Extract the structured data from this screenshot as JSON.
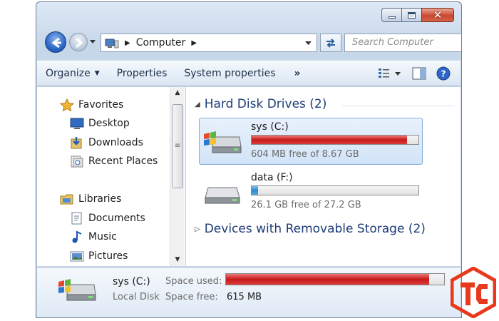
{
  "window": {
    "caption_buttons": [
      "minimize",
      "maximize",
      "close"
    ],
    "close_glyph": "✕"
  },
  "nav": {
    "address_path": [
      "Computer"
    ],
    "address_icon": "computer-icon",
    "search_placeholder": "Search Computer"
  },
  "toolbar": {
    "organize_label": "Organize",
    "properties_label": "Properties",
    "system_properties_label": "System properties",
    "more_label": "»"
  },
  "sidebar": {
    "items": [
      {
        "label": "Favorites",
        "icon": "star-icon"
      },
      {
        "label": "Desktop",
        "icon": "desktop-icon"
      },
      {
        "label": "Downloads",
        "icon": "downloads-icon"
      },
      {
        "label": "Recent Places",
        "icon": "recent-places-icon"
      },
      {
        "label": "Libraries",
        "icon": "libraries-icon"
      },
      {
        "label": "Documents",
        "icon": "documents-icon"
      },
      {
        "label": "Music",
        "icon": "music-icon"
      },
      {
        "label": "Pictures",
        "icon": "pictures-icon"
      }
    ]
  },
  "groups": {
    "hard_disks": {
      "title": "Hard Disk Drives (2)",
      "drives": [
        {
          "name": "sys (C:)",
          "free_text": "604 MB free of 8.67 GB",
          "used_fraction": 0.93,
          "bar_color": "#c61a1a",
          "selected": true
        },
        {
          "name": "data (F:)",
          "free_text": "26.1 GB free of 27.2 GB",
          "used_fraction": 0.04,
          "bar_color": "#2a88cf",
          "selected": false
        }
      ]
    },
    "removable": {
      "title": "Devices with Removable Storage (2)"
    }
  },
  "details": {
    "name": "sys (C:)",
    "type": "Local Disk",
    "space_used_label": "Space used:",
    "space_free_label": "Space free:",
    "space_free_value": "615 MB",
    "used_fraction": 0.93
  },
  "colors": {
    "accent": "#1e3c78",
    "logo": "#e8391d"
  }
}
